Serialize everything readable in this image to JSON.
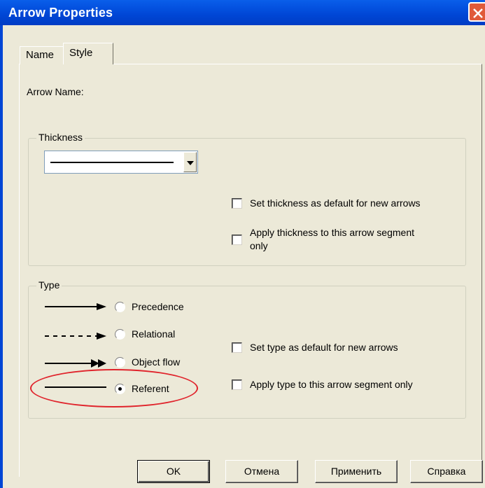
{
  "window": {
    "title": "Arrow Properties"
  },
  "tabs": [
    {
      "label": "Name",
      "active": false
    },
    {
      "label": "Style",
      "active": true
    }
  ],
  "arrow_name_label": "Arrow Name:",
  "thickness": {
    "group_label": "Thickness",
    "checkboxes": [
      {
        "label": "Set thickness as default for new arrows",
        "checked": false
      },
      {
        "label_line1": "Apply thickness to this arrow segment",
        "label_line2": "only",
        "checked": false
      }
    ]
  },
  "type": {
    "group_label": "Type",
    "radios": [
      {
        "label": "Precedence",
        "checked": false,
        "icon": "solid-arrow-icon"
      },
      {
        "label": "Relational",
        "checked": false,
        "icon": "dashed-arrow-icon"
      },
      {
        "label": "Object flow",
        "checked": false,
        "icon": "double-head-arrow-icon"
      },
      {
        "label": "Referent",
        "checked": true,
        "icon": "plain-line-icon"
      }
    ],
    "checkboxes": [
      {
        "label": "Set type as default for new arrows",
        "checked": false
      },
      {
        "label": "Apply type to this arrow segment only",
        "checked": false
      }
    ]
  },
  "buttons": {
    "ok": "OK",
    "cancel": "Отмена",
    "apply": "Применить",
    "help": "Справка"
  },
  "colors": {
    "titlebar": "#0046D5",
    "highlight": "#E0242C",
    "face": "#ECE9D8"
  }
}
